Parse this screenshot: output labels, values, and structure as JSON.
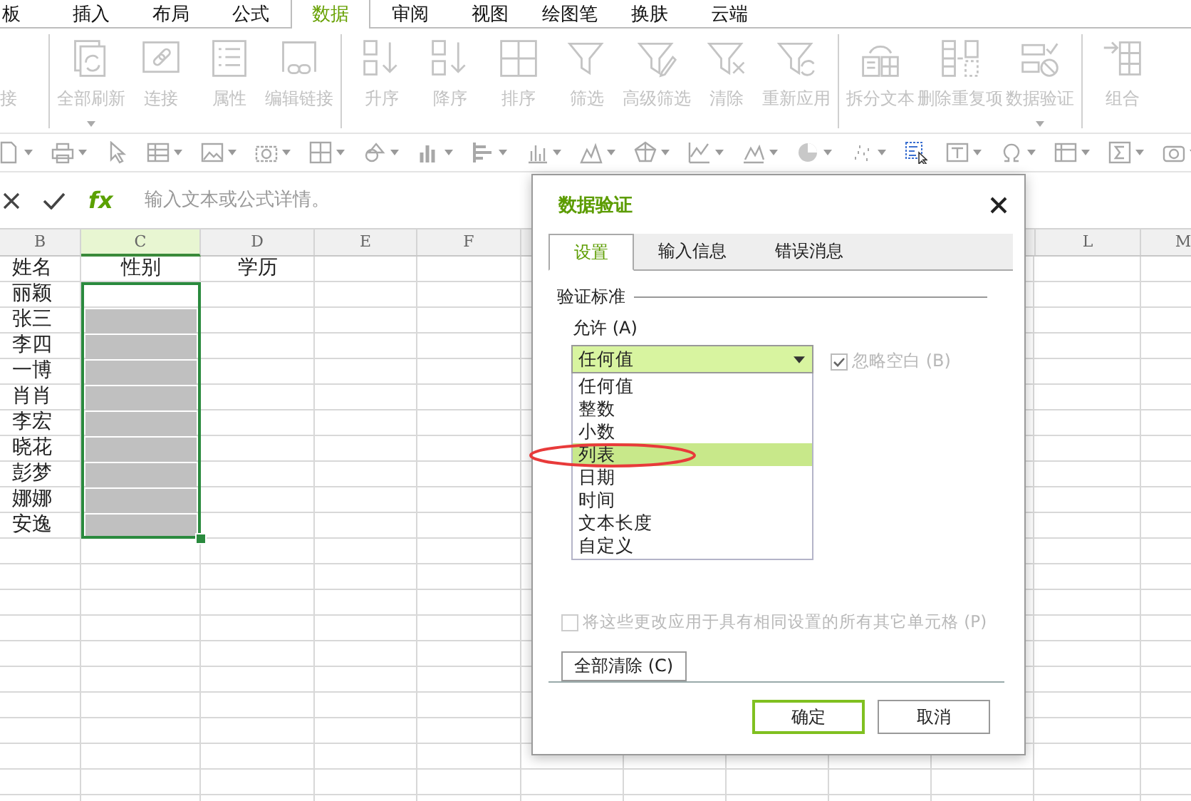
{
  "ribbon_tabs": [
    {
      "label": "板",
      "selected": false
    },
    {
      "label": "插入",
      "selected": false
    },
    {
      "label": "布局",
      "selected": false
    },
    {
      "label": "公式",
      "selected": false
    },
    {
      "label": "数据",
      "selected": true
    },
    {
      "label": "审阅",
      "selected": false
    },
    {
      "label": "视图",
      "selected": false
    },
    {
      "label": "绘图笔",
      "selected": false
    },
    {
      "label": "换肤",
      "selected": false
    },
    {
      "label": "云端",
      "selected": false
    }
  ],
  "ribbon_items": [
    {
      "kind": "button",
      "label": "接",
      "disabled": true,
      "dropdown": false
    },
    {
      "kind": "separator"
    },
    {
      "kind": "button",
      "label": "全部刷新",
      "disabled": true,
      "dropdown": true
    },
    {
      "kind": "button",
      "label": "连接",
      "disabled": true,
      "dropdown": false
    },
    {
      "kind": "button",
      "label": "属性",
      "disabled": true,
      "dropdown": false
    },
    {
      "kind": "button",
      "label": "编辑链接",
      "disabled": true,
      "dropdown": false
    },
    {
      "kind": "separator"
    },
    {
      "kind": "button",
      "label": "升序",
      "disabled": true,
      "dropdown": false
    },
    {
      "kind": "button",
      "label": "降序",
      "disabled": true,
      "dropdown": false
    },
    {
      "kind": "button",
      "label": "排序",
      "disabled": true,
      "dropdown": false
    },
    {
      "kind": "button",
      "label": "筛选",
      "disabled": true,
      "dropdown": false
    },
    {
      "kind": "button",
      "label": "高级筛选",
      "disabled": true,
      "dropdown": false
    },
    {
      "kind": "button",
      "label": "清除",
      "disabled": true,
      "dropdown": false
    },
    {
      "kind": "button",
      "label": "重新应用",
      "disabled": true,
      "dropdown": false
    },
    {
      "kind": "separator"
    },
    {
      "kind": "button",
      "label": "拆分文本",
      "disabled": true,
      "dropdown": false
    },
    {
      "kind": "button",
      "label": "删除重复项",
      "disabled": true,
      "dropdown": false
    },
    {
      "kind": "button",
      "label": "数据验证",
      "disabled": true,
      "dropdown": true
    },
    {
      "kind": "separator"
    },
    {
      "kind": "button",
      "label": "组合",
      "disabled": true,
      "dropdown": false
    }
  ],
  "formula_bar": {
    "fx": "fx",
    "placeholder": "输入文本或公式详情。"
  },
  "sheet": {
    "columns_left": [
      {
        "label": "B",
        "selected": false
      },
      {
        "label": "C",
        "selected": true
      },
      {
        "label": "D",
        "selected": false
      },
      {
        "label": "E",
        "selected": false
      },
      {
        "label": "F",
        "selected": false
      }
    ],
    "columns_right": [
      {
        "label": "L",
        "selected": false
      },
      {
        "label": "M",
        "selected": false
      }
    ],
    "rows": [
      {
        "name": "姓名",
        "gender": "性别",
        "education": "学历",
        "in_selection": false,
        "shaded": false
      },
      {
        "name": "丽颖",
        "in_selection": true,
        "shaded": false
      },
      {
        "name": "张三",
        "in_selection": true,
        "shaded": true
      },
      {
        "name": "李四",
        "in_selection": true,
        "shaded": true
      },
      {
        "name": "一博",
        "in_selection": true,
        "shaded": true
      },
      {
        "name": "肖肖",
        "in_selection": true,
        "shaded": true
      },
      {
        "name": "李宏",
        "in_selection": true,
        "shaded": true
      },
      {
        "name": "晓花",
        "in_selection": true,
        "shaded": true
      },
      {
        "name": "彭梦",
        "in_selection": true,
        "shaded": true
      },
      {
        "name": "娜娜",
        "in_selection": true,
        "shaded": true
      },
      {
        "name": "安逸",
        "in_selection": true,
        "shaded": true
      }
    ]
  },
  "dialog": {
    "title": "数据验证",
    "tabs": [
      {
        "label": "设置",
        "selected": true
      },
      {
        "label": "输入信息",
        "selected": false
      },
      {
        "label": "错误消息",
        "selected": false
      }
    ],
    "section": "验证标准",
    "allow_label": "允许 (A)",
    "allow_value": "任何值",
    "options": [
      {
        "label": "任何值",
        "selected": false
      },
      {
        "label": "整数",
        "selected": false
      },
      {
        "label": "小数",
        "selected": false
      },
      {
        "label": "列表",
        "selected": true
      },
      {
        "label": "日期",
        "selected": false
      },
      {
        "label": "时间",
        "selected": false
      },
      {
        "label": "文本长度",
        "selected": false
      },
      {
        "label": "自定义",
        "selected": false
      }
    ],
    "ignore_blank": {
      "label": "忽略空白 (B)",
      "checked": true,
      "disabled": true
    },
    "apply_all": {
      "label": "将这些更改应用于具有相同设置的所有其它单元格 (P)",
      "checked": false,
      "disabled": true
    },
    "clear_button": "全部清除 (C)",
    "ok_button": "确定",
    "cancel_button": "取消"
  }
}
